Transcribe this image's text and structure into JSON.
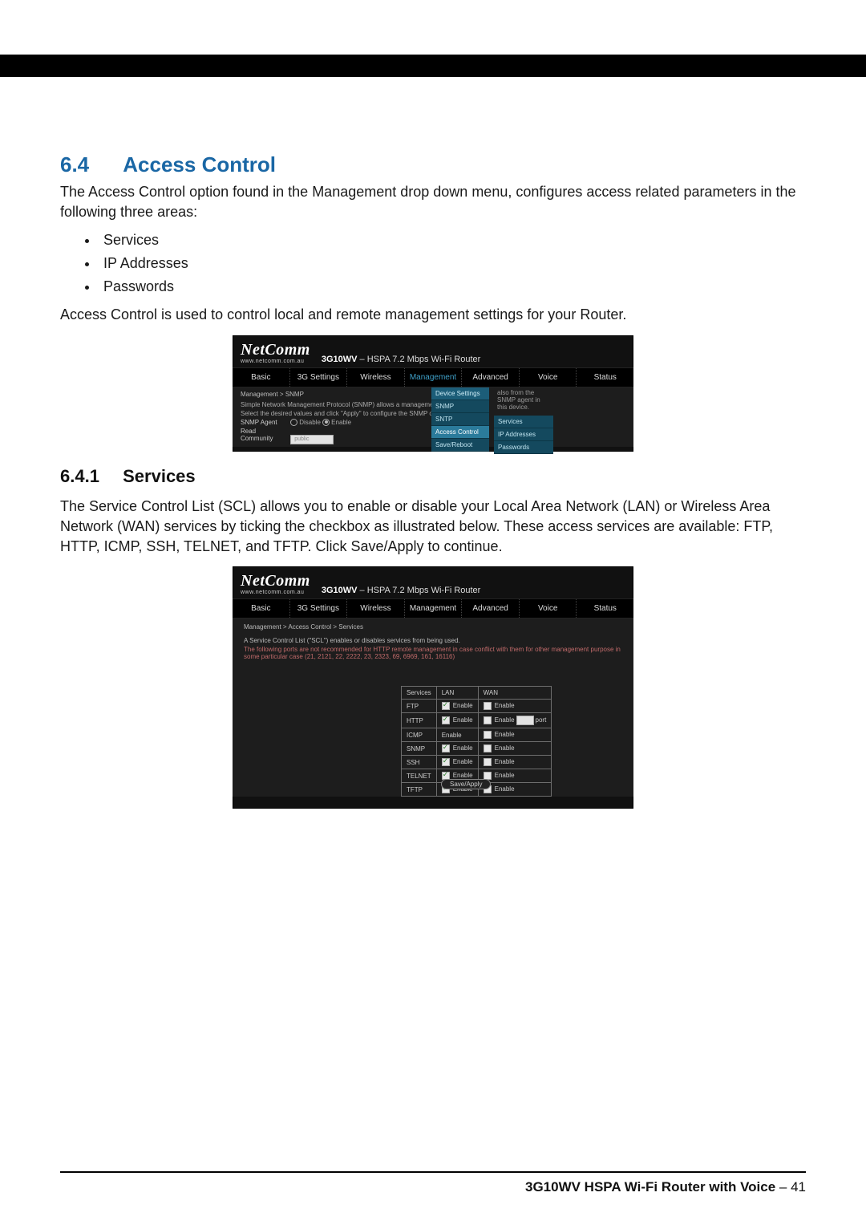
{
  "section_number": "6.4",
  "section_title": "Access Control",
  "intro_para": "The Access Control option found in the Management drop down menu, configures access related parameters in the following three areas:",
  "areas": [
    "Services",
    "IP Addresses",
    "Passwords"
  ],
  "intro_para2": "Access Control is used to control local and remote management settings for your Router.",
  "subsection_number": "6.4.1",
  "subsection_title": "Services",
  "sub_para": "The Service Control List (SCL) allows you to enable or disable your Local Area Network (LAN) or Wireless Area Network (WAN) services by ticking the checkbox as illustrated below. These access services are available: FTP, HTTP, ICMP, SSH, TELNET, and TFTP. Click Save/Apply to continue.",
  "router": {
    "brand": "NetComm",
    "brand_sub": "www.netcomm.com.au",
    "device_title_model": "3G10WV",
    "device_title_rest": " – HSPA 7.2 Mbps Wi-Fi Router",
    "nav": [
      "Basic",
      "3G Settings",
      "Wireless",
      "Management",
      "Advanced",
      "Voice",
      "Status"
    ]
  },
  "shot1": {
    "breadcrumb": "Management > SNMP",
    "line1": "Simple Network Management Protocol (SNMP) allows a management application",
    "line_right": "also from the SNMP agent in this device.",
    "line2": "Select the desired values and click \"Apply\" to configure the SNMP options.",
    "snmp_agent_label": "SNMP Agent",
    "radio_disable": "Disable",
    "radio_enable": "Enable",
    "read_community_label": "Read Community",
    "read_community_value": "public",
    "dropdown": [
      "Device Settings",
      "SNMP",
      "SNTP",
      "Access Control",
      "Save/Reboot"
    ],
    "rightcol": [
      "Services",
      "IP Addresses",
      "Passwords"
    ]
  },
  "shot2": {
    "breadcrumb": "Management > Access Control > Services",
    "desc1": "A Service Control List (\"SCL\") enables or disables services from being used.",
    "desc2": "The following ports are not recommended for HTTP remote management in case conflict with them for other management purpose in some particular case (21, 2121, 22, 2222, 23, 2323, 69, 6969, 161, 16116)",
    "col1": "Services",
    "col2": "LAN",
    "col3": "WAN",
    "enable_label": "Enable",
    "port_label": "port",
    "rows": [
      {
        "name": "FTP",
        "lan_box": true,
        "lan_checked": true,
        "wan_checked": false,
        "wan_has_port": false
      },
      {
        "name": "HTTP",
        "lan_box": true,
        "lan_checked": true,
        "wan_checked": false,
        "wan_has_port": true
      },
      {
        "name": "ICMP",
        "lan_box": false,
        "lan_checked": false,
        "wan_checked": false,
        "wan_has_port": false
      },
      {
        "name": "SNMP",
        "lan_box": true,
        "lan_checked": true,
        "wan_checked": false,
        "wan_has_port": false
      },
      {
        "name": "SSH",
        "lan_box": true,
        "lan_checked": true,
        "wan_checked": false,
        "wan_has_port": false
      },
      {
        "name": "TELNET",
        "lan_box": true,
        "lan_checked": true,
        "wan_checked": false,
        "wan_has_port": false
      },
      {
        "name": "TFTP",
        "lan_box": true,
        "lan_checked": true,
        "wan_checked": false,
        "wan_has_port": false
      }
    ],
    "save_apply": "Save/Apply"
  },
  "footer": {
    "product": "3G10WV HSPA Wi-Fi Router with Voice",
    "sep": " – ",
    "page": "41"
  }
}
